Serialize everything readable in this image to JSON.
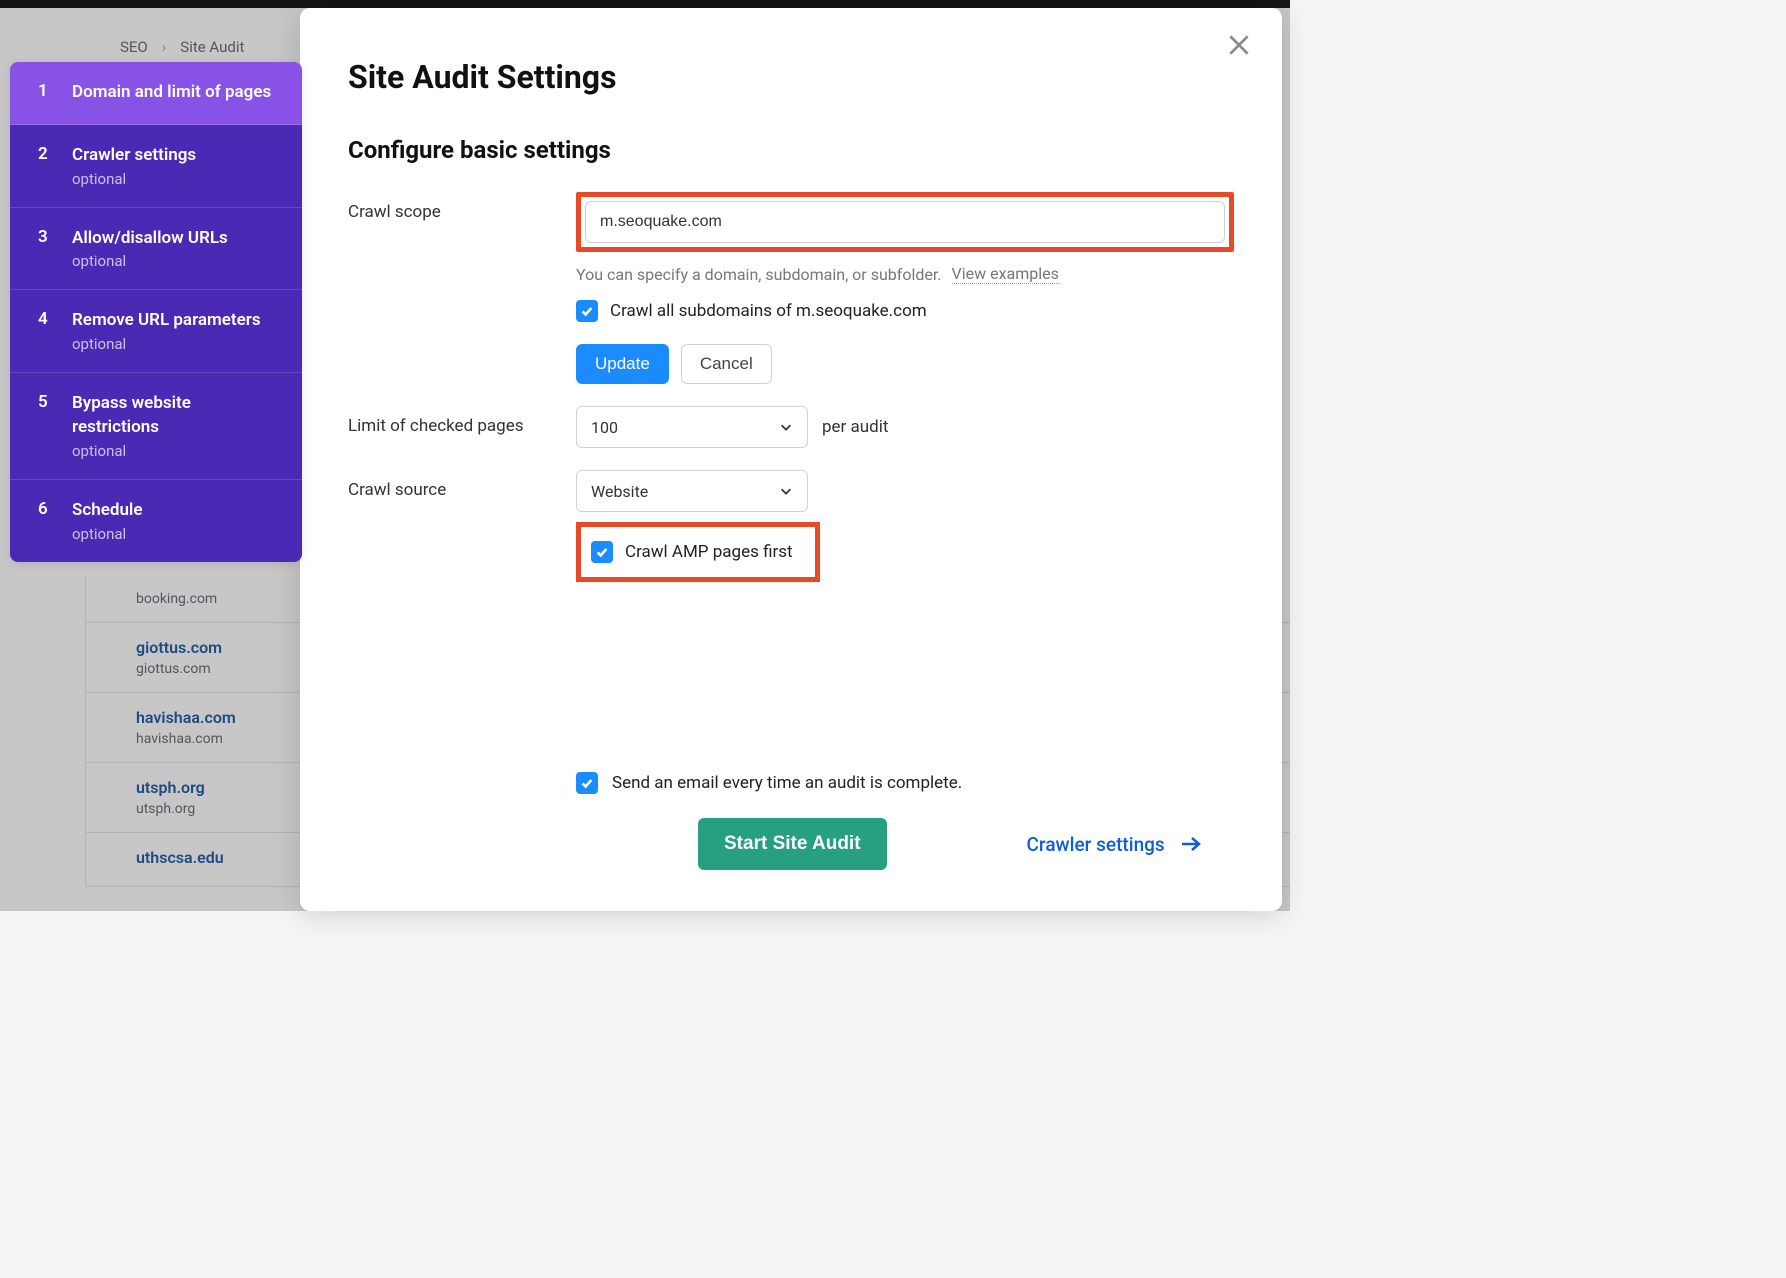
{
  "breadcrumb": {
    "item1": "SEO",
    "item2": "Site Audit"
  },
  "bgRows": [
    {
      "title": "booking.com",
      "sub": ""
    },
    {
      "title": "giottus.com",
      "sub": "giottus.com"
    },
    {
      "title": "havishaa.com",
      "sub": "havishaa.com"
    },
    {
      "title": "utsph.org",
      "sub": "utsph.org"
    },
    {
      "title": "uthscsa.edu",
      "sub": ""
    }
  ],
  "sidebar": {
    "steps": [
      {
        "num": "1",
        "title": "Domain and limit of pages",
        "optional": ""
      },
      {
        "num": "2",
        "title": "Crawler settings",
        "optional": "optional"
      },
      {
        "num": "3",
        "title": "Allow/disallow URLs",
        "optional": "optional"
      },
      {
        "num": "4",
        "title": "Remove URL parameters",
        "optional": "optional"
      },
      {
        "num": "5",
        "title": "Bypass website restrictions",
        "optional": "optional"
      },
      {
        "num": "6",
        "title": "Schedule",
        "optional": "optional"
      }
    ]
  },
  "modal": {
    "title": "Site Audit Settings",
    "subtitle": "Configure basic settings",
    "crawlScope": {
      "label": "Crawl scope",
      "value": "m.seoquake.com",
      "helper": "You can specify a domain, subdomain, or subfolder.",
      "examplesLink": "View examples",
      "cbLabel": "Crawl all subdomains of m.seoquake.com",
      "updateBtn": "Update",
      "cancelBtn": "Cancel"
    },
    "limit": {
      "label": "Limit of checked pages",
      "value": "100",
      "suffix": "per audit"
    },
    "source": {
      "label": "Crawl source",
      "value": "Website",
      "ampLabel": "Crawl AMP pages first"
    },
    "emailCb": "Send an email every time an audit is complete.",
    "startBtn": "Start Site Audit",
    "nextLink": "Crawler settings"
  }
}
